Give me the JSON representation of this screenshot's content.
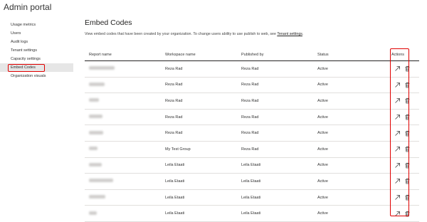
{
  "app": {
    "title": "Admin portal"
  },
  "sidebar": {
    "items": [
      {
        "label": "Usage metrics"
      },
      {
        "label": "Users"
      },
      {
        "label": "Audit logs"
      },
      {
        "label": "Tenant settings"
      },
      {
        "label": "Capacity settings"
      },
      {
        "label": "Embed Codes",
        "active": true
      },
      {
        "label": "Organization visuals"
      }
    ]
  },
  "main": {
    "title": "Embed Codes",
    "description": "View embed codes that have been created by your organization. To change users ability to use publish to web, see ",
    "link_text": "Tenant settings",
    "description_end": "."
  },
  "table": {
    "headers": [
      "Report name",
      "Workspace name",
      "Published by",
      "Status",
      "Actions"
    ],
    "rows": [
      {
        "workspace": "Reza Rad",
        "published_by": "Reza Rad",
        "status": "Active"
      },
      {
        "workspace": "Reza Rad",
        "published_by": "Reza Rad",
        "status": "Active"
      },
      {
        "workspace": "Reza Rad",
        "published_by": "Reza Rad",
        "status": "Active"
      },
      {
        "workspace": "Reza Rad",
        "published_by": "Reza Rad",
        "status": "Active"
      },
      {
        "workspace": "Reza Rad",
        "published_by": "Reza Rad",
        "status": "Active"
      },
      {
        "workspace": "My Test Group",
        "published_by": "Reza Rad",
        "status": "Active"
      },
      {
        "workspace": "Leila Etaati",
        "published_by": "Leila Etaati",
        "status": "Active"
      },
      {
        "workspace": "Leila Etaati",
        "published_by": "Leila Etaati",
        "status": "Active"
      },
      {
        "workspace": "Leila Etaati",
        "published_by": "Leila Etaati",
        "status": "Active"
      },
      {
        "workspace": "Leila Etaati",
        "published_by": "Leila Etaati",
        "status": "Active"
      }
    ]
  },
  "icons": {
    "open": "arrow-up-right-icon",
    "delete": "trash-icon"
  },
  "colors": {
    "highlight": "#e00000",
    "active_bg": "#e6e6e6"
  }
}
